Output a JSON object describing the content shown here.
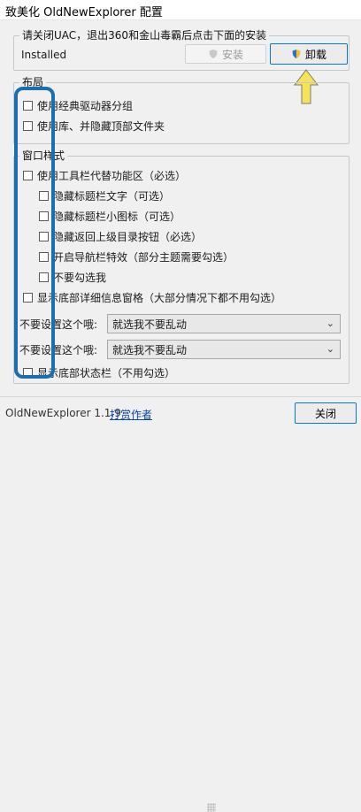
{
  "window": {
    "title": "致美化 OldNewExplorer 配置"
  },
  "install_group": {
    "title": "请关闭UAC，退出360和金山毒霸后点击下面的安装",
    "status": "Installed",
    "install_label": "安装",
    "uninstall_label": "卸载"
  },
  "layout_group": {
    "title": "布局",
    "items": [
      {
        "label": "使用经典驱动器分组"
      },
      {
        "label": "使用库、并隐藏顶部文件夹"
      }
    ]
  },
  "window_style_group": {
    "title": "窗口样式",
    "items": [
      {
        "label": "使用工具栏代替功能区（必选）"
      },
      {
        "label": "隐藏标题栏文字（可选）"
      },
      {
        "label": "隐藏标题栏小图标（可选）"
      },
      {
        "label": "隐藏返回上级目录按钮（必选）"
      },
      {
        "label": "开启导航栏特效（部分主题需要勾选）"
      },
      {
        "label": "不要勾选我"
      },
      {
        "label": "显示底部详细信息窗格（大部分情况下都不用勾选）"
      }
    ],
    "combos": [
      {
        "label": "不要设置这个哦:",
        "value": "就选我不要乱动"
      },
      {
        "label": "不要设置这个哦:",
        "value": "就选我不要乱动"
      }
    ],
    "status_bar_item": {
      "label": "显示底部状态栏（不用勾选）"
    }
  },
  "footer": {
    "version": "OldNewExplorer 1.1.9",
    "reward_link": "打赏作者",
    "close_label": "关闭"
  },
  "colors": {
    "highlight": "#1c6fae",
    "arrow": "#f7e35a",
    "link": "#0645ad"
  }
}
